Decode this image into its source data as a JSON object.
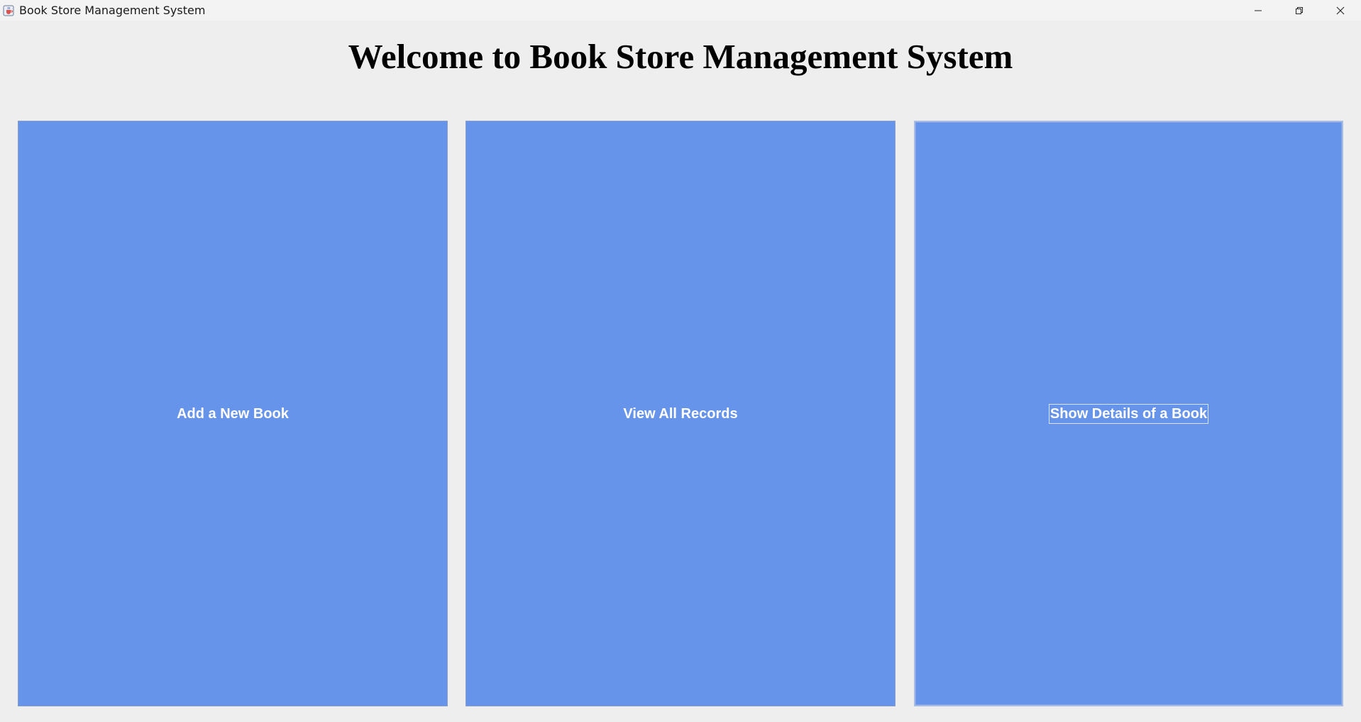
{
  "window": {
    "title": "Book Store Management System",
    "icons": {
      "app": "java-cup-icon",
      "minimize": "minimize-icon",
      "restore": "restore-icon",
      "close": "close-icon"
    }
  },
  "main": {
    "heading": "Welcome to Book Store Management System",
    "buttons": [
      {
        "label": "Add a New Book"
      },
      {
        "label": "View All Records"
      },
      {
        "label": "Show Details of a Book",
        "focused": true
      }
    ]
  },
  "colors": {
    "button_bg": "#6694ea",
    "button_text": "#ffffff",
    "window_bg": "#eeeeee"
  }
}
